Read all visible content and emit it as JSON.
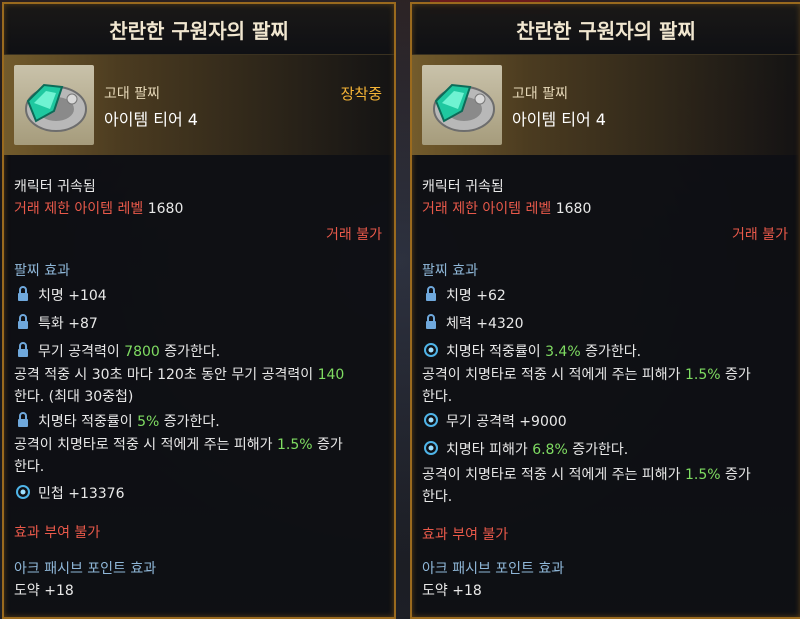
{
  "left": {
    "title": "찬란한 구원자의 팔찌",
    "grade": "고대 팔찌",
    "tier": "아이템 티어 4",
    "equipped": "장착중",
    "bound": "캐릭터 귀속됨",
    "trade_level_label": "거래 제한 아이템 레벨",
    "trade_level_value": "1680",
    "trade_status": "거래 불가",
    "effect_header": "팔찌 효과",
    "stat1": "치명 +104",
    "stat2": "특화 +87",
    "eff1_pre": "무기 공격력이 ",
    "eff1_val": "7800",
    "eff1_post": " 증가한다.",
    "eff2_l1_pre": "공격 적중 시 30초 마다 120초 동안 무기 공격력이 ",
    "eff2_l1_val": "140",
    "eff2_l2": "한다. (최대 30중첩)",
    "eff3_pre": "치명타 적중률이 ",
    "eff3_val": "5%",
    "eff3_post": " 증가한다.",
    "eff4_l1_pre": "공격이 치명타로 적중 시 적에게 주는 피해가 ",
    "eff4_l1_val": "1.5%",
    "eff4_l1_post": " 증가",
    "eff4_l2": "한다.",
    "stat3": "민첩 +13376",
    "no_grant": "효과 부여 불가",
    "ark_header": "아크 패시브 포인트 효과",
    "ark_value": "도약 +18"
  },
  "right": {
    "title": "찬란한 구원자의 팔찌",
    "grade": "고대 팔찌",
    "tier": "아이템 티어 4",
    "bound": "캐릭터 귀속됨",
    "trade_level_label": "거래 제한 아이템 레벨",
    "trade_level_value": "1680",
    "trade_status": "거래 불가",
    "effect_header": "팔찌 효과",
    "stat1": "치명 +62",
    "stat2": "체력 +4320",
    "eff1_pre": "치명타 적중률이 ",
    "eff1_val": "3.4%",
    "eff1_post": " 증가한다.",
    "eff2_l1_pre": "공격이 치명타로 적중 시 적에게 주는 피해가 ",
    "eff2_l1_val": "1.5%",
    "eff2_l1_post": " 증가",
    "eff2_l2": "한다.",
    "eff3": "무기 공격력 +9000",
    "eff4_pre": "치명타 피해가 ",
    "eff4_val": "6.8%",
    "eff4_post": " 증가한다.",
    "eff5_l1_pre": "공격이 치명타로 적중 시 적에게 주는 피해가 ",
    "eff5_l1_val": "1.5%",
    "eff5_l1_post": " 증가",
    "eff5_l2": "한다.",
    "no_grant": "효과 부여 불가",
    "ark_header": "아크 패시브 포인트 효과",
    "ark_value": "도약 +18"
  },
  "colors": {
    "gold_border": "#9a6a1e",
    "equipped": "#f4b336",
    "red": "#e8594a",
    "blue": "#8fb7d8",
    "green": "#7fdc62"
  },
  "icons": [
    "bracelet-icon",
    "lock-icon",
    "swirl-icon"
  ]
}
